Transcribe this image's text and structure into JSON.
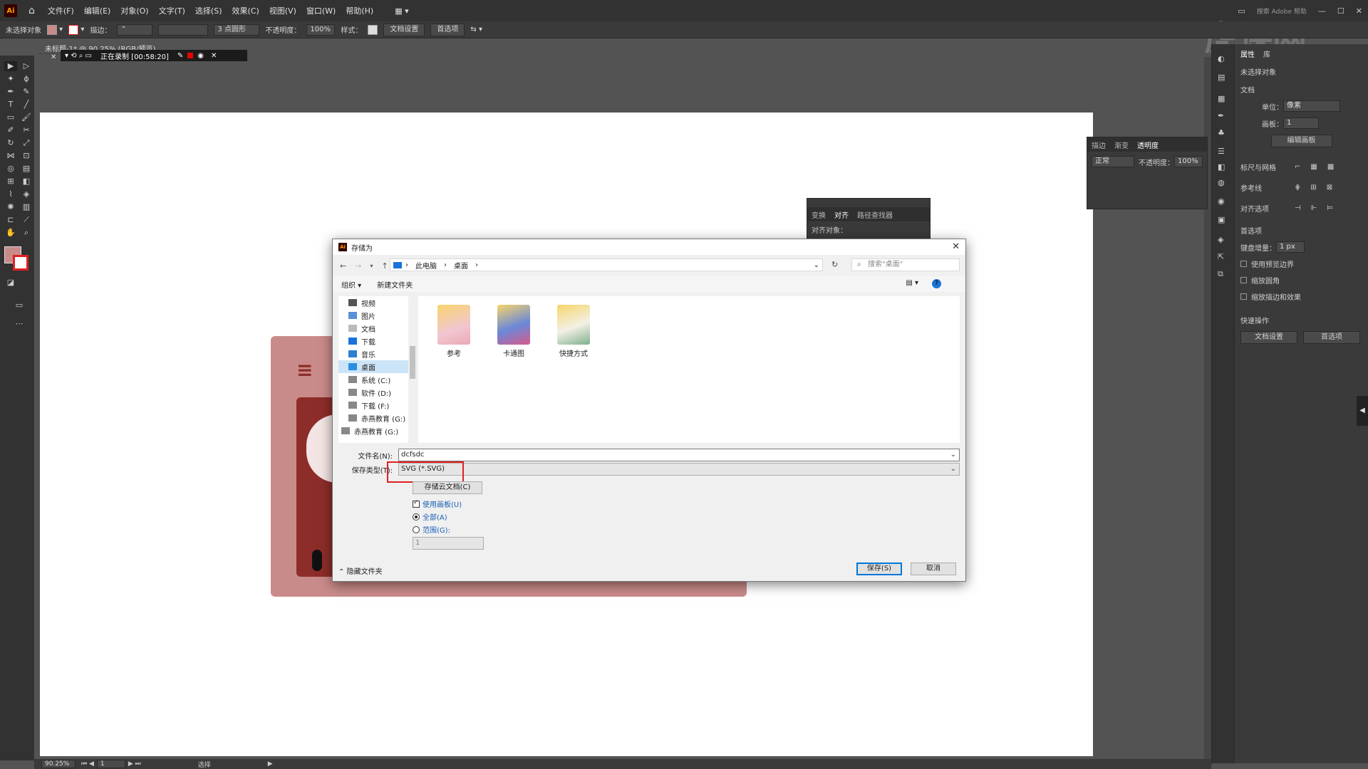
{
  "menubar": {
    "logo": "Ai",
    "items": [
      "文件(F)",
      "编辑(E)",
      "对象(O)",
      "文字(T)",
      "选择(S)",
      "效果(C)",
      "视图(V)",
      "窗口(W)",
      "帮助(H)"
    ],
    "search": "搜索 Adobe 帮助"
  },
  "control": {
    "selection": "未选择对象",
    "stroke_label": "描边：",
    "brush": "3 点圆形",
    "opacity_label": "不透明度：",
    "opacity": "100%",
    "style_label": "样式：",
    "doc_setup": "文档设置",
    "prefs": "首选项",
    "fill_color": "#c98b89"
  },
  "doc": {
    "tab": "未标题-1* @ 90.25% (RGB/预览)",
    "recording": "正在录制 [00:58:20]"
  },
  "status": {
    "zoom": "90.25%",
    "artboard": "1",
    "tool": "选择"
  },
  "properties": {
    "tabs": [
      "属性",
      "库"
    ],
    "no_selection": "未选择对象",
    "document": "文档",
    "units_label": "单位：",
    "units": "像素",
    "artboard_label": "画板：",
    "artboard": "1",
    "edit_artboards": "编辑画板",
    "rulers_grids": "标尺与网格",
    "guides": "参考线",
    "snap": "对齐选项",
    "prefs_title": "首选项",
    "key_increment_label": "键盘增量：",
    "key_increment": "1 px",
    "checks": [
      "使用预览边界",
      "缩放圆角",
      "缩放描边和效果"
    ],
    "quick_actions": "快速操作",
    "doc_setup": "文档设置",
    "prefs_btn": "首选项"
  },
  "transparency_panel": {
    "tabs": [
      "描边",
      "渐变",
      "透明度"
    ],
    "mode": "正常",
    "opacity_label": "不透明度：",
    "opacity": "100%"
  },
  "align_panel": {
    "tabs": [
      "变换",
      "对齐",
      "路径查找器"
    ],
    "label": "对齐对象："
  },
  "dialog": {
    "title": "存储为",
    "breadcrumbs": [
      "此电脑",
      "桌面"
    ],
    "search_placeholder": "搜索\"桌面\"",
    "organize": "组织 ▾",
    "new_folder": "新建文件夹",
    "nav_items": [
      "视频",
      "图片",
      "文档",
      "下载",
      "音乐",
      "桌面",
      "系统 (C:)",
      "软件 (D:)",
      "下载 (F:)",
      "赤燕教育 (G:)",
      "赤燕教育 (G:)"
    ],
    "nav_selected": 5,
    "folders": [
      {
        "name": "参考",
        "color": "#f2c6d0"
      },
      {
        "name": "卡通图",
        "color": "#6a88d8"
      },
      {
        "name": "快捷方式",
        "color": "#f3f0e6"
      }
    ],
    "filename_label": "文件名(N):",
    "filename": "dcfsdc",
    "filetype_label": "保存类型(T):",
    "filetype": "SVG (*.SVG)",
    "save_cloud": "存储云文档(C)",
    "use_artboards": "使用画板(U)",
    "all": "全部(A)",
    "range": "范围(G):",
    "range_value": "1",
    "hide_folders": "隐藏文件夹",
    "save": "保存(S)",
    "cancel": "取消"
  },
  "colors": {
    "card": "#c98b89",
    "accent_red": "#8d2d29",
    "highlight_box": "#e02020"
  }
}
